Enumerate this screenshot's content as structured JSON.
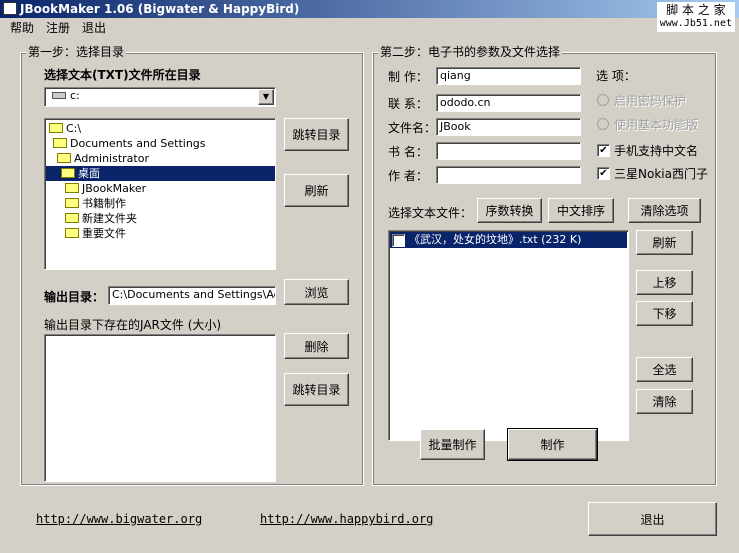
{
  "window": {
    "title": "JBookMaker 1.06 (Bigwater & HappyBird)",
    "watermark_line1": "脚 本 之 家",
    "watermark_line2": "www.Jb51.net"
  },
  "menu": [
    "帮助",
    "注册",
    "退出"
  ],
  "step1": {
    "legend": "第一步：选择目录",
    "dir_label": "选择文本(TXT)文件所在目录",
    "drive": "c:",
    "tree": [
      {
        "label": "C:\\",
        "indent": 0
      },
      {
        "label": "Documents and Settings",
        "indent": 1
      },
      {
        "label": "Administrator",
        "indent": 2
      },
      {
        "label": "桌面",
        "indent": 3,
        "selected": true
      },
      {
        "label": "JBookMaker",
        "indent": 4
      },
      {
        "label": "书籍制作",
        "indent": 4
      },
      {
        "label": "新建文件夹",
        "indent": 4
      },
      {
        "label": "重要文件",
        "indent": 4
      }
    ],
    "goto_button": "跳转目录",
    "refresh_button": "刷新",
    "output_label": "输出目录：",
    "output_value": "C:\\Documents and Settings\\Administrator\\桌面",
    "browse_button": "浏览",
    "jar_label": "输出目录下存在的JAR文件 (大小)",
    "delete_button": "删除",
    "goto_button2": "跳转目录"
  },
  "step2": {
    "legend": "第二步：电子书的参数及文件选择",
    "fields": [
      {
        "label": "制 作：",
        "value": "qiang"
      },
      {
        "label": "联 系：",
        "value": "ododo.cn"
      },
      {
        "label": "文件名：",
        "value": "JBook"
      },
      {
        "label": "书 名：",
        "value": ""
      },
      {
        "label": "作 者：",
        "value": ""
      }
    ],
    "options_label": "选 项：",
    "options": [
      {
        "label": "启用密码保护",
        "type": "radio",
        "enabled": false,
        "checked": false
      },
      {
        "label": "使用基本功能版",
        "type": "radio",
        "enabled": false,
        "checked": false
      },
      {
        "label": "手机支持中文名",
        "type": "checkbox",
        "enabled": true,
        "checked": true
      },
      {
        "label": "三星Nokia西门子",
        "type": "checkbox",
        "enabled": true,
        "checked": true
      }
    ],
    "select_label": "选择文本文件：",
    "seq_button": "序数转换",
    "sort_button": "中文排序",
    "clear_opt_button": "清除选项",
    "files": [
      {
        "name": "《武汉，处女的坟地》.txt (232 K)",
        "checked": false,
        "selected": true
      }
    ],
    "refresh_button": "刷新",
    "up_button": "上移",
    "down_button": "下移",
    "all_button": "全选",
    "clear_button": "清除",
    "batch_button": "批量制作",
    "make_button": "制作"
  },
  "footer": {
    "link1": "http://www.bigwater.org",
    "link2": "http://www.happybird.org",
    "exit_button": "退出"
  }
}
